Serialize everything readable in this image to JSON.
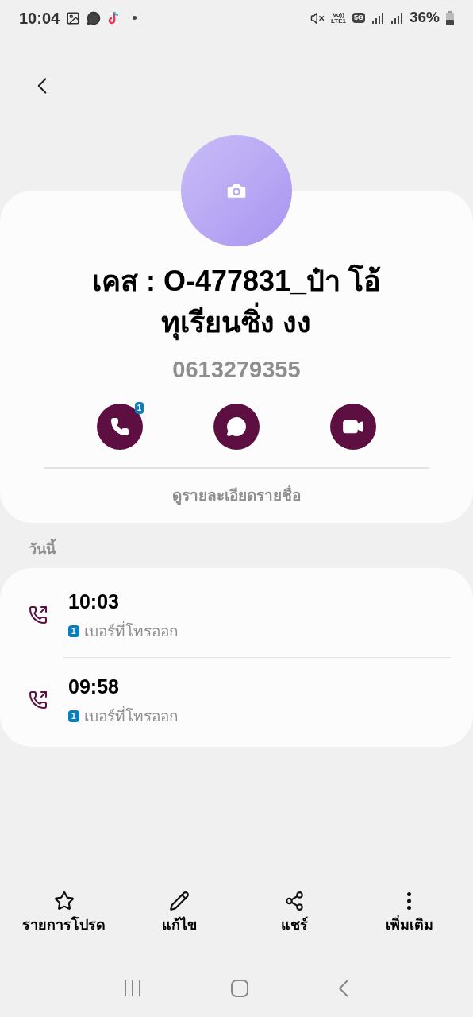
{
  "status_bar": {
    "time": "10:04",
    "network_top": "Vo))",
    "network_bottom": "LTE1",
    "network_type": "5G",
    "battery": "36%"
  },
  "contact": {
    "name_lines": [
      "เคส : O-477831_ป๋า โอ้",
      "ทุเรียนซิ่ง งง"
    ],
    "phone": "0613279355",
    "call_badge": "1",
    "details_link": "ดูรายละเอียดรายชื่อ"
  },
  "history": {
    "heading": "วันนี้",
    "calls": [
      {
        "time": "10:03",
        "sim": "1",
        "label": "เบอร์ที่โทรออก"
      },
      {
        "time": "09:58",
        "sim": "1",
        "label": "เบอร์ที่โทรออก"
      }
    ]
  },
  "toolbar": [
    {
      "kind": "star",
      "label": "รายการโปรด"
    },
    {
      "kind": "edit",
      "label": "แก้ไข"
    },
    {
      "kind": "share",
      "label": "แชร์"
    },
    {
      "kind": "more",
      "label": "เพิ่มเติม"
    }
  ]
}
